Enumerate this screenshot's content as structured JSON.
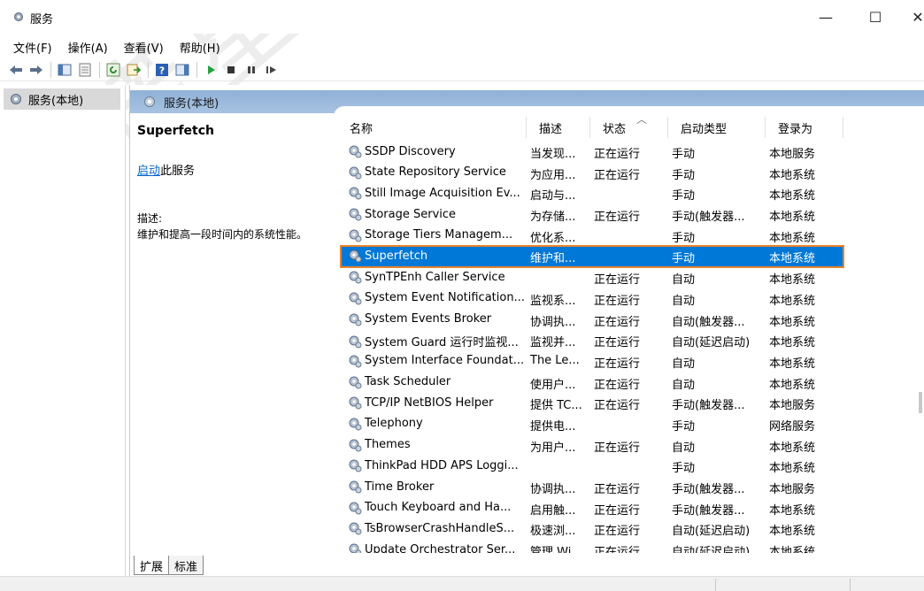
{
  "window": {
    "title": "服务",
    "minimize": "—",
    "maximize": "☐",
    "close": "✕"
  },
  "menu": [
    "文件(F)",
    "操作(A)",
    "查看(V)",
    "帮助(H)"
  ],
  "tree": {
    "item": "服务(本地)"
  },
  "main": {
    "header": "服务(本地)",
    "selected_title": "Superfetch",
    "action_link": "启动",
    "action_suffix": "此服务",
    "desc_label": "描述:",
    "desc_text": "维护和提高一段时间内的系统性能。"
  },
  "columns": [
    "名称",
    "描述",
    "状态",
    "启动类型",
    "登录为"
  ],
  "rows": [
    {
      "name": "SSDP Discovery",
      "desc": "当发现...",
      "state": "正在运行",
      "type": "手动",
      "logon": "本地服务"
    },
    {
      "name": "State Repository Service",
      "desc": "为应用...",
      "state": "正在运行",
      "type": "手动",
      "logon": "本地系统"
    },
    {
      "name": "Still Image Acquisition Ev...",
      "desc": "启动与...",
      "state": "",
      "type": "手动",
      "logon": "本地系统"
    },
    {
      "name": "Storage Service",
      "desc": "为存储...",
      "state": "正在运行",
      "type": "手动(触发器...",
      "logon": "本地系统"
    },
    {
      "name": "Storage Tiers Managem...",
      "desc": "优化系...",
      "state": "",
      "type": "手动",
      "logon": "本地系统"
    },
    {
      "name": "Superfetch",
      "desc": "维护和...",
      "state": "",
      "type": "手动",
      "logon": "本地系统",
      "selected": true
    },
    {
      "name": "SynTPEnh Caller Service",
      "desc": "",
      "state": "正在运行",
      "type": "自动",
      "logon": "本地系统"
    },
    {
      "name": "System Event Notification...",
      "desc": "监视系...",
      "state": "正在运行",
      "type": "自动",
      "logon": "本地系统"
    },
    {
      "name": "System Events Broker",
      "desc": "协调执...",
      "state": "正在运行",
      "type": "自动(触发器...",
      "logon": "本地系统"
    },
    {
      "name": "System Guard 运行时监视...",
      "desc": "监视并...",
      "state": "正在运行",
      "type": "自动(延迟启动)",
      "logon": "本地系统"
    },
    {
      "name": "System Interface Foundat...",
      "desc": "The Le...",
      "state": "正在运行",
      "type": "自动",
      "logon": "本地系统"
    },
    {
      "name": "Task Scheduler",
      "desc": "使用户...",
      "state": "正在运行",
      "type": "自动",
      "logon": "本地系统"
    },
    {
      "name": "TCP/IP NetBIOS Helper",
      "desc": "提供 TC...",
      "state": "正在运行",
      "type": "手动(触发器...",
      "logon": "本地服务"
    },
    {
      "name": "Telephony",
      "desc": "提供电...",
      "state": "",
      "type": "手动",
      "logon": "网络服务"
    },
    {
      "name": "Themes",
      "desc": "为用户...",
      "state": "正在运行",
      "type": "自动",
      "logon": "本地系统"
    },
    {
      "name": "ThinkPad HDD APS Loggi...",
      "desc": "",
      "state": "",
      "type": "手动",
      "logon": "本地系统"
    },
    {
      "name": "Time Broker",
      "desc": "协调执...",
      "state": "正在运行",
      "type": "手动(触发器...",
      "logon": "本地服务"
    },
    {
      "name": "Touch Keyboard and Ha...",
      "desc": "启用触...",
      "state": "正在运行",
      "type": "手动(触发器...",
      "logon": "本地系统"
    },
    {
      "name": "TsBrowserCrashHandleS...",
      "desc": "极速浏...",
      "state": "正在运行",
      "type": "自动(延迟启动)",
      "logon": "本地系统"
    },
    {
      "name": "Update Orchestrator Ser...",
      "desc": "管理 Wi...",
      "state": "正在运行",
      "type": "自动(延迟启动)",
      "logon": "本地系统"
    }
  ],
  "tabs": [
    "扩展",
    "标准"
  ],
  "colors": {
    "selection": "#0078d7",
    "highlight_outline": "#e8832a",
    "header_band": "#9bb8dc",
    "link": "#0066cc"
  }
}
